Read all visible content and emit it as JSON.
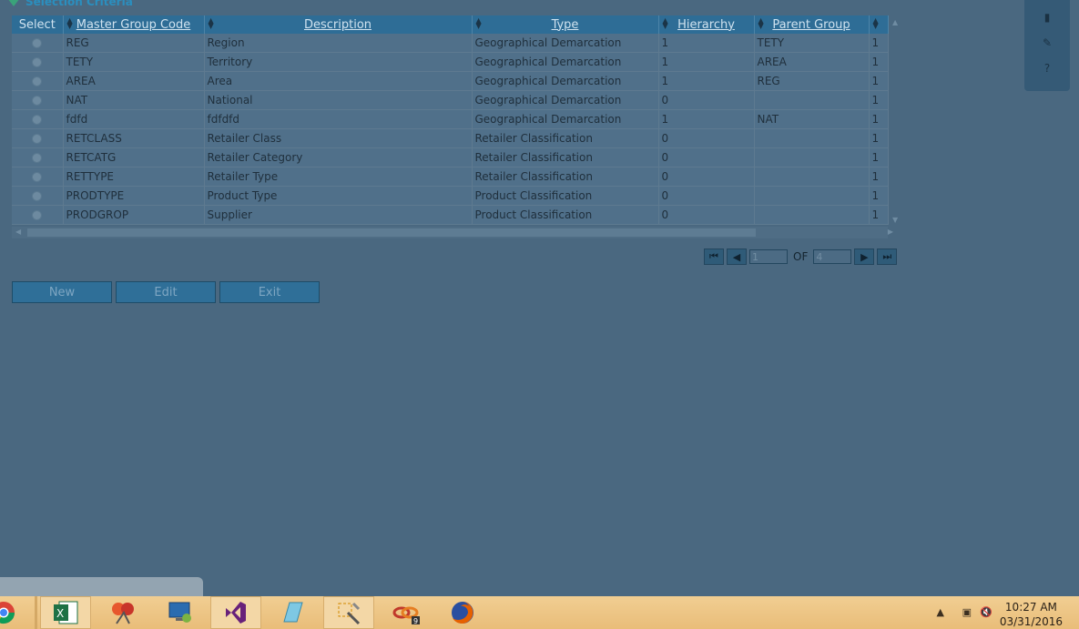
{
  "section": {
    "title": "Selection Criteria"
  },
  "grid": {
    "columns": [
      "Select",
      "Master Group Code",
      "Description",
      "Type",
      "Hierarchy",
      "Parent Group",
      ""
    ],
    "rows": [
      [
        "REG",
        "Region",
        "Geographical Demarcation",
        "1",
        "TETY",
        "1"
      ],
      [
        "TETY",
        "Territory",
        "Geographical Demarcation",
        "1",
        "AREA",
        "1"
      ],
      [
        "AREA",
        "Area",
        "Geographical Demarcation",
        "1",
        "REG",
        "1"
      ],
      [
        "NAT",
        "National",
        "Geographical Demarcation",
        "0",
        "",
        "1"
      ],
      [
        "fdfd",
        "fdfdfd",
        "Geographical Demarcation",
        "1",
        "NAT",
        "1"
      ],
      [
        "RETCLASS",
        "Retailer Class",
        "Retailer Classification",
        "0",
        "",
        "1"
      ],
      [
        "RETCATG",
        "Retailer Category",
        "Retailer Classification",
        "0",
        "",
        "1"
      ],
      [
        "RETTYPE",
        "Retailer Type",
        "Retailer Classification",
        "0",
        "",
        "1"
      ],
      [
        "PRODTYPE",
        "Product Type",
        "Product Classification",
        "0",
        "",
        "1"
      ],
      [
        "PRODGROP",
        "Supplier",
        "Product Classification",
        "0",
        "",
        "1"
      ]
    ]
  },
  "pager": {
    "page": "1",
    "of_label": "OF",
    "total": "4"
  },
  "actions": {
    "new": "New",
    "edit": "Edit",
    "exit": "Exit"
  },
  "clock": {
    "time": "10:27 AM",
    "date": "03/31/2016"
  },
  "taskbar": {
    "icons": [
      "chrome-icon",
      "excel-icon",
      "snipping-icon",
      "remote-desktop-icon",
      "visual-studio-icon",
      "notepad-icon",
      "paint-tool-icon",
      "network-tool-icon",
      "firefox-icon"
    ]
  }
}
